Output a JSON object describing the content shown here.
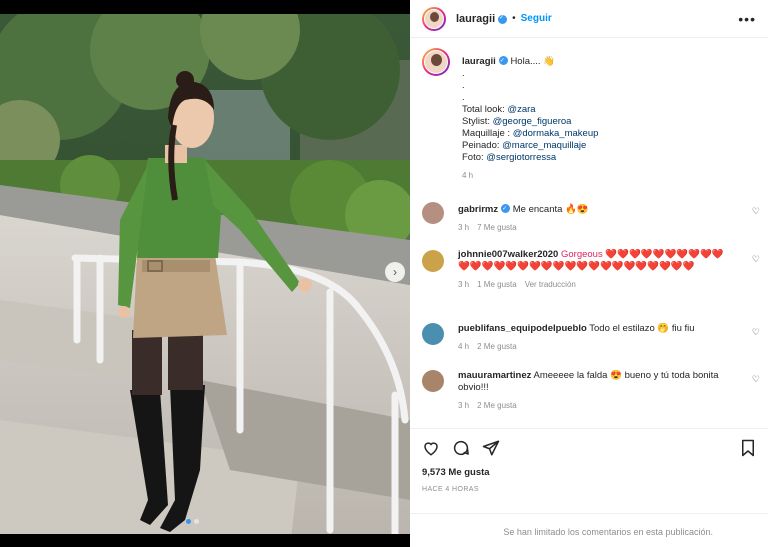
{
  "post": {
    "username": "lauragii",
    "follow_label": "Seguir",
    "more_label": "•••",
    "separator": "•"
  },
  "caption": {
    "username": "lauragii",
    "greeting": "Hola.... 👋",
    "dots": [
      ".",
      ".",
      "."
    ],
    "lines": [
      {
        "label": "Total look: ",
        "mention": "@zara"
      },
      {
        "label": "Stylist: ",
        "mention": "@george_figueroa"
      },
      {
        "label": "Maquillaje : ",
        "mention": "@dormaka_makeup"
      },
      {
        "label": "Peinado: ",
        "mention": "@marce_maquillaje"
      },
      {
        "label": "Foto: ",
        "mention": "@sergiotorressa"
      }
    ],
    "time": "4 h"
  },
  "comments": [
    {
      "username": "gabrirmz",
      "text": "Me encanta 🔥😍",
      "time": "3 h",
      "likes": "7 Me gusta",
      "reply": "",
      "avatar_color": "#b59080"
    },
    {
      "username": "johnnie007walker2020",
      "text": "Gorgeous ❤️❤️❤️❤️❤️❤️❤️❤️❤️❤️❤️❤️❤️❤️❤️❤️❤️❤️❤️❤️❤️❤️❤️❤️❤️❤️❤️❤️❤️❤️",
      "time": "3 h",
      "likes": "1 Me gusta",
      "reply": "Ver traducción",
      "avatar_color": "#c9a24a"
    },
    {
      "username": "pueblifans_equipodelpueblo",
      "text": "Todo el estilazo 🤭 fiu fiu",
      "time": "4 h",
      "likes": "2 Me gusta",
      "reply": "",
      "avatar_color": "#4a8fb0"
    },
    {
      "username": "mauuramartinez",
      "text": "Ameeeee la falda 😍 bueno y tú toda bonita obvio!!!",
      "time": "3 h",
      "likes": "2 Me gusta",
      "reply": "",
      "avatar_color": "#a8846a"
    }
  ],
  "actions": {
    "like_icon": "heart-icon",
    "comment_icon": "comment-icon",
    "share_icon": "share-icon",
    "save_icon": "bookmark-icon",
    "likes_count": "9,573 Me gusta",
    "posted_ago": "HACE 4 HORAS",
    "limited_notice": "Se han limitado los comentarios en esta publicación."
  },
  "colors": {
    "accent": "#0095f6",
    "mention": "#00376b",
    "muted": "#8e8e8e"
  }
}
